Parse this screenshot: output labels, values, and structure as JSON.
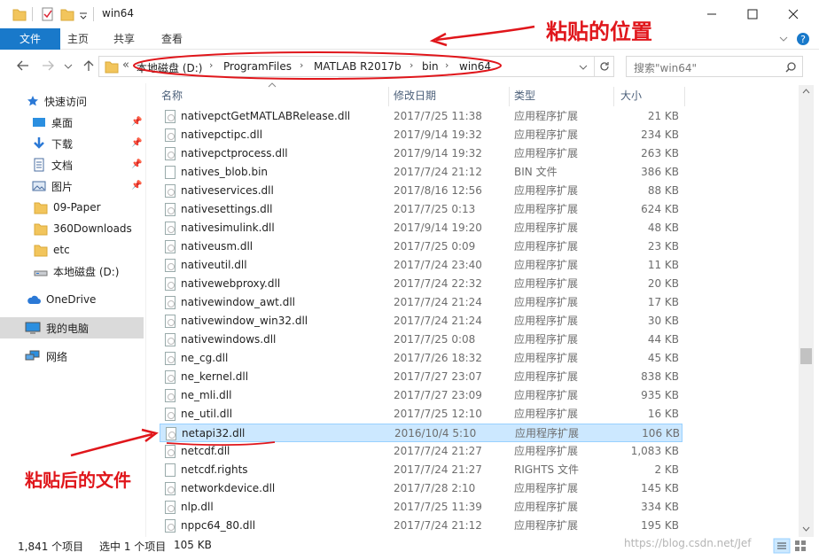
{
  "window": {
    "title": "win64"
  },
  "ribbon": {
    "tabs": [
      "文件",
      "主页",
      "共享",
      "查看"
    ]
  },
  "address": {
    "crumbs": [
      "本地磁盘 (D:)",
      "ProgramFiles",
      "MATLAB R2017b",
      "bin",
      "win64"
    ],
    "prefix": "«"
  },
  "search": {
    "placeholder": "搜索\"win64\""
  },
  "nav": {
    "items": [
      {
        "label": "快速访问",
        "icon": "star-icon"
      },
      {
        "label": "桌面",
        "icon": "desktop-icon",
        "pinned": true
      },
      {
        "label": "下载",
        "icon": "download-icon",
        "pinned": true
      },
      {
        "label": "文档",
        "icon": "document-icon",
        "pinned": true
      },
      {
        "label": "图片",
        "icon": "picture-icon",
        "pinned": true
      },
      {
        "label": "09-Paper",
        "icon": "folder-icon"
      },
      {
        "label": "360Downloads",
        "icon": "folder-icon"
      },
      {
        "label": "etc",
        "icon": "folder-icon"
      },
      {
        "label": "本地磁盘 (D:)",
        "icon": "drive-icon"
      },
      {
        "label": "OneDrive",
        "icon": "cloud-icon"
      },
      {
        "label": "我的电脑",
        "icon": "computer-icon"
      },
      {
        "label": "网络",
        "icon": "network-icon"
      }
    ]
  },
  "columns": {
    "name": "名称",
    "date": "修改日期",
    "type": "类型",
    "size": "大小"
  },
  "files": [
    {
      "name": "nativepctGetMATLABRelease.dll",
      "date": "2017/7/25 11:38",
      "type": "应用程序扩展",
      "size": "21 KB"
    },
    {
      "name": "nativepctipc.dll",
      "date": "2017/9/14 19:32",
      "type": "应用程序扩展",
      "size": "234 KB"
    },
    {
      "name": "nativepctprocess.dll",
      "date": "2017/9/14 19:32",
      "type": "应用程序扩展",
      "size": "263 KB"
    },
    {
      "name": "natives_blob.bin",
      "date": "2017/7/24 21:12",
      "type": "BIN 文件",
      "size": "386 KB"
    },
    {
      "name": "nativeservices.dll",
      "date": "2017/8/16 12:56",
      "type": "应用程序扩展",
      "size": "88 KB"
    },
    {
      "name": "nativesettings.dll",
      "date": "2017/7/25 0:13",
      "type": "应用程序扩展",
      "size": "624 KB"
    },
    {
      "name": "nativesimulink.dll",
      "date": "2017/9/14 19:20",
      "type": "应用程序扩展",
      "size": "48 KB"
    },
    {
      "name": "nativeusm.dll",
      "date": "2017/7/25 0:09",
      "type": "应用程序扩展",
      "size": "23 KB"
    },
    {
      "name": "nativeutil.dll",
      "date": "2017/7/24 23:40",
      "type": "应用程序扩展",
      "size": "11 KB"
    },
    {
      "name": "nativewebproxy.dll",
      "date": "2017/7/24 22:32",
      "type": "应用程序扩展",
      "size": "20 KB"
    },
    {
      "name": "nativewindow_awt.dll",
      "date": "2017/7/24 21:24",
      "type": "应用程序扩展",
      "size": "17 KB"
    },
    {
      "name": "nativewindow_win32.dll",
      "date": "2017/7/24 21:24",
      "type": "应用程序扩展",
      "size": "30 KB"
    },
    {
      "name": "nativewindows.dll",
      "date": "2017/7/25 0:08",
      "type": "应用程序扩展",
      "size": "44 KB"
    },
    {
      "name": "ne_cg.dll",
      "date": "2017/7/26 18:32",
      "type": "应用程序扩展",
      "size": "45 KB"
    },
    {
      "name": "ne_kernel.dll",
      "date": "2017/7/27 23:07",
      "type": "应用程序扩展",
      "size": "838 KB"
    },
    {
      "name": "ne_mli.dll",
      "date": "2017/7/27 23:09",
      "type": "应用程序扩展",
      "size": "935 KB"
    },
    {
      "name": "ne_util.dll",
      "date": "2017/7/25 12:10",
      "type": "应用程序扩展",
      "size": "16 KB"
    },
    {
      "name": "netapi32.dll",
      "date": "2016/10/4 5:10",
      "type": "应用程序扩展",
      "size": "106 KB",
      "selected": true
    },
    {
      "name": "netcdf.dll",
      "date": "2017/7/24 21:27",
      "type": "应用程序扩展",
      "size": "1,083 KB"
    },
    {
      "name": "netcdf.rights",
      "date": "2017/7/24 21:27",
      "type": "RIGHTS 文件",
      "size": "2 KB"
    },
    {
      "name": "networkdevice.dll",
      "date": "2017/7/28 2:10",
      "type": "应用程序扩展",
      "size": "145 KB"
    },
    {
      "name": "nlp.dll",
      "date": "2017/7/25 11:39",
      "type": "应用程序扩展",
      "size": "334 KB"
    },
    {
      "name": "nppc64_80.dll",
      "date": "2017/7/24 21:12",
      "type": "应用程序扩展",
      "size": "195 KB"
    }
  ],
  "status": {
    "count": "1,841 个项目",
    "selected": "选中 1 个项目",
    "size": "105 KB"
  },
  "annotations": {
    "location": "粘贴的位置",
    "pasted": "粘贴后的文件",
    "color": "#e0161b"
  },
  "watermark": "https://blog.csdn.net/Jef"
}
